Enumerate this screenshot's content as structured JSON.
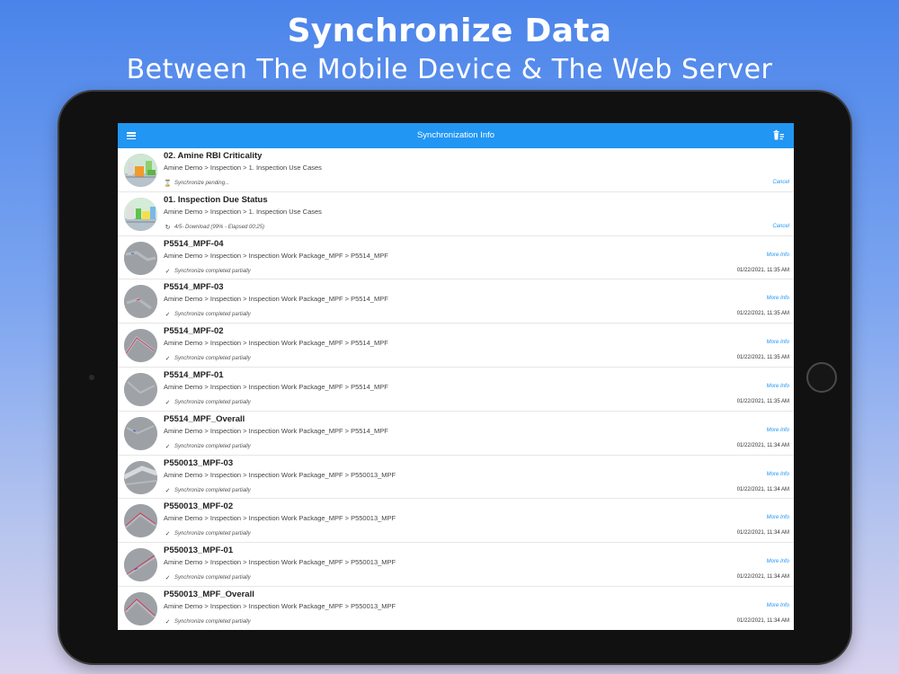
{
  "headline": "Synchronize Data",
  "subheadline": "Between The Mobile Device & The Web Server",
  "navbar": {
    "title": "Synchronization Info",
    "menu_icon": "hamburger-menu-icon",
    "action_icon": "trash-list-icon",
    "color": "#2196f3"
  },
  "accent_color": "#2196f3",
  "rows": [
    {
      "title": "02. Amine RBI Criticality",
      "path": "Amine Demo > Inspection > 1. Inspection Use Cases",
      "status": "Synchronize pending...",
      "status_icon": "hourglass-icon",
      "action": "Cancel",
      "time": ""
    },
    {
      "title": "01. Inspection Due Status",
      "path": "Amine Demo > Inspection > 1. Inspection Use Cases",
      "status": "4/5- Download (99% - Elapsed 00:25)",
      "status_icon": "sync-icon",
      "action": "Cancel",
      "time": ""
    },
    {
      "title": "P5514_MPF-04",
      "path": "Amine Demo > Inspection > Inspection Work Package_MPF > P5514_MPF",
      "status": "Synchronize completed partially",
      "status_icon": "check-icon",
      "action": "More Info",
      "time": "01/22/2021, 11:35 AM"
    },
    {
      "title": "P5514_MPF-03",
      "path": "Amine Demo > Inspection > Inspection Work Package_MPF > P5514_MPF",
      "status": "Synchronize completed partially",
      "status_icon": "check-icon",
      "action": "More Info",
      "time": "01/22/2021, 11:35 AM"
    },
    {
      "title": "P5514_MPF-02",
      "path": "Amine Demo > Inspection > Inspection Work Package_MPF > P5514_MPF",
      "status": "Synchronize completed partially",
      "status_icon": "check-icon",
      "action": "More Info",
      "time": "01/22/2021, 11:35 AM"
    },
    {
      "title": "P5514_MPF-01",
      "path": "Amine Demo > Inspection > Inspection Work Package_MPF > P5514_MPF",
      "status": "Synchronize completed partially",
      "status_icon": "check-icon",
      "action": "More Info",
      "time": "01/22/2021, 11:35 AM"
    },
    {
      "title": "P5514_MPF_Overall",
      "path": "Amine Demo > Inspection > Inspection Work Package_MPF > P5514_MPF",
      "status": "Synchronize completed partially",
      "status_icon": "check-icon",
      "action": "More Info",
      "time": "01/22/2021, 11:34 AM"
    },
    {
      "title": "P550013_MPF-03",
      "path": "Amine Demo > Inspection > Inspection Work Package_MPF > P550013_MPF",
      "status": "Synchronize completed partially",
      "status_icon": "check-icon",
      "action": "More Info",
      "time": "01/22/2021, 11:34 AM"
    },
    {
      "title": "P550013_MPF-02",
      "path": "Amine Demo > Inspection > Inspection Work Package_MPF > P550013_MPF",
      "status": "Synchronize completed partially",
      "status_icon": "check-icon",
      "action": "More Info",
      "time": "01/22/2021, 11:34 AM"
    },
    {
      "title": "P550013_MPF-01",
      "path": "Amine Demo > Inspection > Inspection Work Package_MPF > P550013_MPF",
      "status": "Synchronize completed partially",
      "status_icon": "check-icon",
      "action": "More Info",
      "time": "01/22/2021, 11:34 AM"
    },
    {
      "title": "P550013_MPF_Overall",
      "path": "Amine Demo > Inspection > Inspection Work Package_MPF > P550013_MPF",
      "status": "Synchronize completed partially",
      "status_icon": "check-icon",
      "action": "More Info",
      "time": "01/22/2021, 11:34 AM"
    }
  ]
}
